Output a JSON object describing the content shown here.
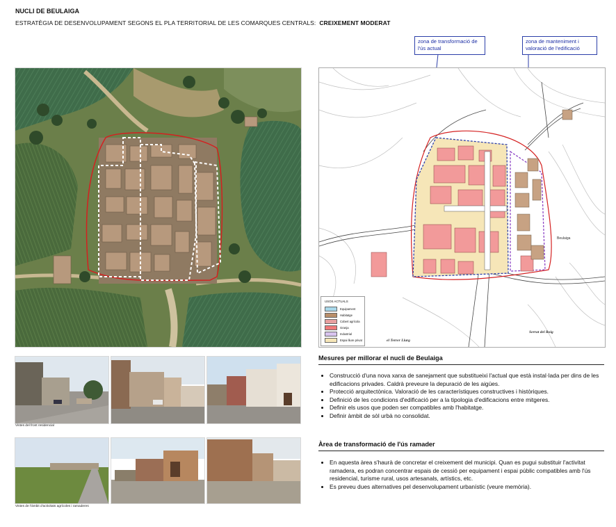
{
  "header": {
    "title": "NUCLI DE BEULAIGA",
    "subtitle_main": "ESTRATÈGIA DE DESENVOLUPAMENT SEGONS EL PLA TERRITORIAL DE LES COMARQUES CENTRALS:",
    "subtitle_strategy": "CREIXEMENT MODERAT"
  },
  "callouts": {
    "transformation": "zona de transformació de l'ús actual",
    "maintenance": "zona de manteniment i valoració de l'edificació"
  },
  "map": {
    "legend_title": "USOS ACTUALS",
    "legend": [
      {
        "label": "Equipament",
        "color": "#a8d8ea"
      },
      {
        "label": "Habitatge",
        "color": "#b98e6a"
      },
      {
        "label": "Cobert agrícola",
        "color": "#e8a0a0"
      },
      {
        "label": "Granja",
        "color": "#f07a7a"
      },
      {
        "label": "Industrial",
        "color": "#d8c3ee"
      },
      {
        "label": "Espai lliure privat",
        "color": "#f6e6b8"
      }
    ],
    "places": {
      "terrer": "el Terrer Llarg",
      "serrat": "Serrat del Roig",
      "beulaiga": "Beulaiga"
    }
  },
  "photos": {
    "caption_top": "Vistes del front residencial",
    "caption_bottom": "Vistes de l'àmbit d'activitats agrícoles i ramaderes"
  },
  "measures": {
    "title": "Mesures per millorar el nucli de Beulaiga",
    "items": [
      "Construcció d'una nova xarxa de sanejament que substitueixi l'actual que està instal·lada per dins de les edificacions privades. Caldrà preveure la depuració de les aigües.",
      "Protecció arquitectònica. Valoració de les característiques constructives i històriques.",
      "Definició de les condicions d'edificació per a la tipologia d'edificacions entre mitgeres.",
      "Definir els usos que poden ser compatibles amb l'habitatge.",
      "Definir àmbit de sòl urbà no consolidat."
    ]
  },
  "transformation_area": {
    "title": "Àrea de transformació de l'ús ramader",
    "items": [
      "En aquesta àrea s'haurà de concretar el creixement del municipi. Quan es pugui substituir l'activitat ramadera, es podran concentrar espais de cessió per equipament i espai públic compatibles amb l'ús residencial, turisme rural, usos artesanals, artístics, etc.",
      "Es preveu dues alternatives pel desenvolupament urbanístic (veure memòria)."
    ]
  }
}
